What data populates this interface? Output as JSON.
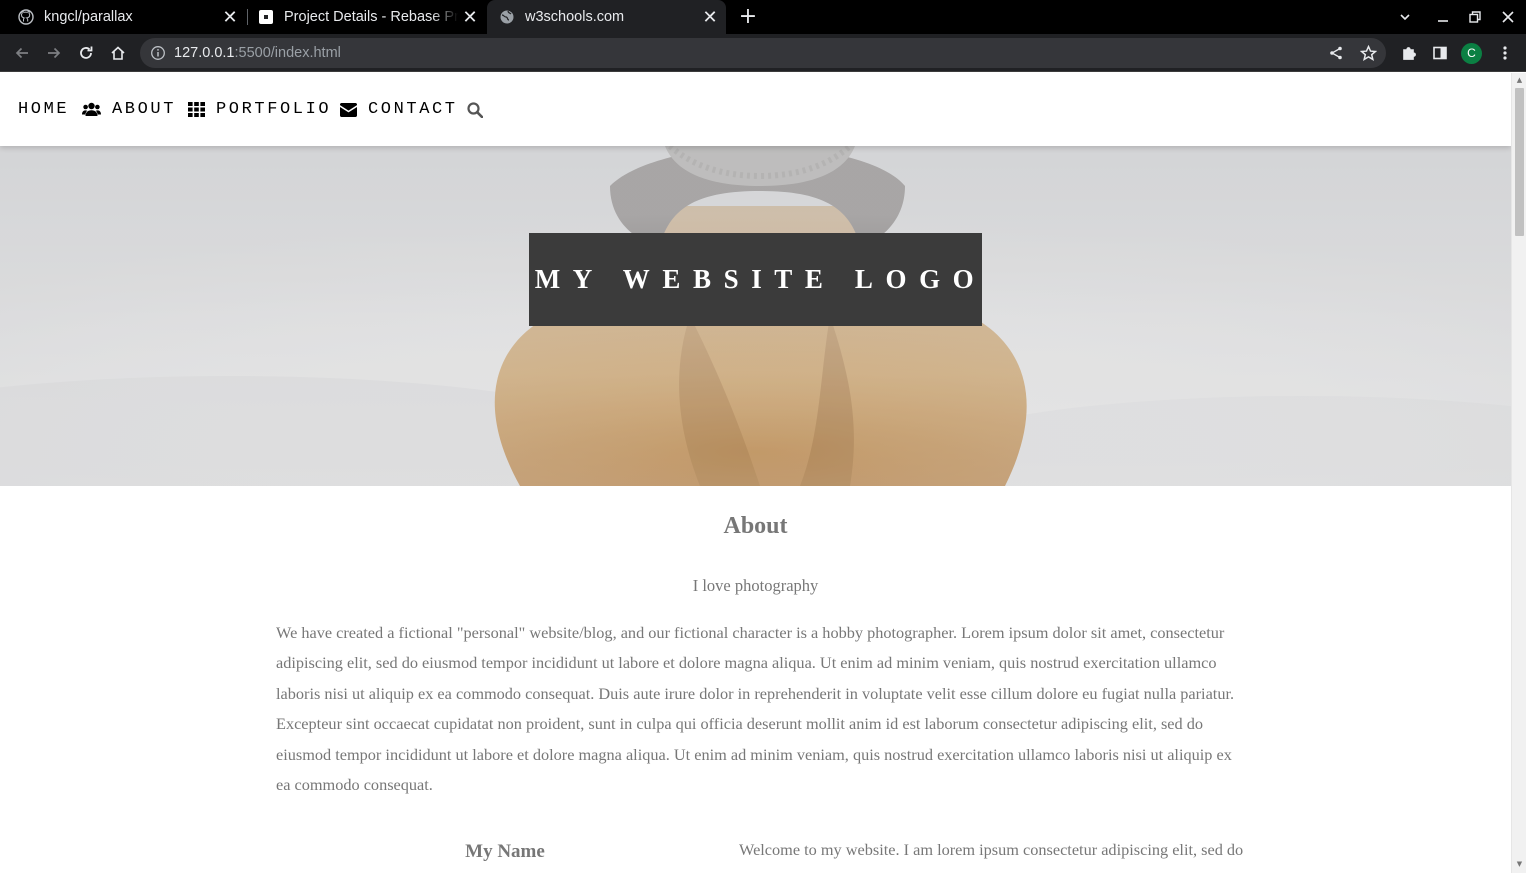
{
  "browser": {
    "tabs": [
      {
        "title": "kngcl/parallax",
        "icon": "github-icon"
      },
      {
        "title": "Project Details - Rebase Pr",
        "icon": "page-icon"
      },
      {
        "title": "w3schools.com",
        "icon": "globe-icon",
        "active": true
      }
    ],
    "url_host": "127.0.0.1",
    "url_path": ":5500/index.html",
    "profile_initial": "C"
  },
  "nav": {
    "items": [
      {
        "label": "HOME",
        "icon": ""
      },
      {
        "label": "ABOUT",
        "icon": "users-icon"
      },
      {
        "label": "PORTFOLIO",
        "icon": "grid-icon"
      },
      {
        "label": "CONTACT",
        "icon": "envelope-icon"
      }
    ],
    "search_icon": "search-icon"
  },
  "hero": {
    "logo_text": "MY WEBSITE LOGO"
  },
  "about": {
    "title": "About",
    "subtitle": "I love photography",
    "body": "We have created a fictional \"personal\" website/blog, and our fictional character is a hobby photographer. Lorem ipsum dolor sit amet, consectetur adipiscing elit, sed do eiusmod tempor incididunt ut labore et dolore magna aliqua. Ut enim ad minim veniam, quis nostrud exercitation ullamco laboris nisi ut aliquip ex ea commodo consequat. Duis aute irure dolor in reprehenderit in voluptate velit esse cillum dolore eu fugiat nulla pariatur. Excepteur sint occaecat cupidatat non proident, sunt in culpa qui officia deserunt mollit anim id est laborum consectetur adipiscing elit, sed do eiusmod tempor incididunt ut labore et dolore magna aliqua. Ut enim ad minim veniam, quis nostrud exercitation ullamco laboris nisi ut aliquip ex ea commodo consequat.",
    "name_heading": "My Name",
    "welcome": "Welcome to my website. I am lorem ipsum consectetur adipiscing elit, sed do eiusmod tempor incididunt ut labore et dolore magna aliqua. Ut enim ad"
  },
  "colors": {
    "text_gray": "#777777",
    "logo_box": "#3b3b3b",
    "browser_dark": "#202124"
  }
}
